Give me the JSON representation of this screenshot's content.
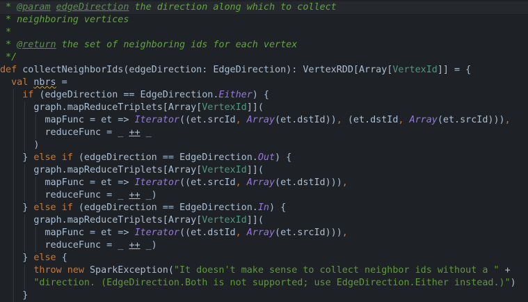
{
  "editor": {
    "highlighted_line": 0,
    "lines": [
      [
        [
          "c",
          " * "
        ],
        [
          "ct",
          "@param"
        ],
        [
          "c",
          " "
        ],
        [
          "ct",
          "edgeDirection"
        ],
        [
          "c",
          " the direction along which to collect"
        ]
      ],
      [
        [
          "c",
          " * neighboring vertices"
        ]
      ],
      [
        [
          "c",
          " *"
        ]
      ],
      [
        [
          "c",
          " * "
        ],
        [
          "ct",
          "@return"
        ],
        [
          "c",
          " the set of neighboring ids for each vertex"
        ]
      ],
      [
        [
          "c",
          " */"
        ]
      ],
      [
        [
          "k",
          "def "
        ],
        [
          "t",
          "collectNeighborIds(edgeDirection: EdgeDirection): VertexRDD[Array["
        ],
        [
          "ty",
          "VertexId"
        ],
        [
          "t",
          "]] = {"
        ]
      ],
      [
        [
          "t",
          "  "
        ],
        [
          "k",
          "val "
        ],
        [
          "w",
          "nbrs"
        ],
        [
          "t",
          " ="
        ]
      ],
      [
        [
          "t",
          "    "
        ],
        [
          "k",
          "if "
        ],
        [
          "t",
          "(edgeDirection == EdgeDirection."
        ],
        [
          "i",
          "Either"
        ],
        [
          "t",
          ") {"
        ]
      ],
      [
        [
          "t",
          "      graph.mapReduceTriplets[Array["
        ],
        [
          "ty",
          "VertexId"
        ],
        [
          "t",
          "]]("
        ]
      ],
      [
        [
          "t",
          "        mapFunc = et => "
        ],
        [
          "i",
          "Iterator"
        ],
        [
          "t",
          "((et.srcId"
        ],
        [
          "p",
          ", "
        ],
        [
          "i",
          "Array"
        ],
        [
          "t",
          "(et.dstId))"
        ],
        [
          "p",
          ", "
        ],
        [
          "t",
          "(et.dstId"
        ],
        [
          "p",
          ", "
        ],
        [
          "i",
          "Array"
        ],
        [
          "t",
          "(et.srcId)))"
        ],
        [
          "p",
          ","
        ]
      ],
      [
        [
          "t",
          "        reduceFunc = _ "
        ],
        [
          "u",
          "++"
        ],
        [
          "t",
          " _"
        ]
      ],
      [
        [
          "t",
          "      )"
        ]
      ],
      [
        [
          "t",
          "    } "
        ],
        [
          "k",
          "else if "
        ],
        [
          "t",
          "(edgeDirection == EdgeDirection."
        ],
        [
          "i",
          "Out"
        ],
        [
          "t",
          ") {"
        ]
      ],
      [
        [
          "t",
          "      graph.mapReduceTriplets[Array["
        ],
        [
          "ty",
          "VertexId"
        ],
        [
          "t",
          "]]("
        ]
      ],
      [
        [
          "t",
          "        mapFunc = et => "
        ],
        [
          "i",
          "Iterator"
        ],
        [
          "t",
          "((et.srcId"
        ],
        [
          "p",
          ", "
        ],
        [
          "i",
          "Array"
        ],
        [
          "t",
          "(et.dstId)))"
        ],
        [
          "p",
          ","
        ]
      ],
      [
        [
          "t",
          "        reduceFunc = _ "
        ],
        [
          "u",
          "++"
        ],
        [
          "t",
          " _)"
        ]
      ],
      [
        [
          "t",
          "    } "
        ],
        [
          "k",
          "else if "
        ],
        [
          "t",
          "(edgeDirection == EdgeDirection."
        ],
        [
          "i",
          "In"
        ],
        [
          "t",
          ") {"
        ]
      ],
      [
        [
          "t",
          "      graph.mapReduceTriplets[Array["
        ],
        [
          "ty",
          "VertexId"
        ],
        [
          "t",
          "]]("
        ]
      ],
      [
        [
          "t",
          "        mapFunc = et => "
        ],
        [
          "i",
          "Iterator"
        ],
        [
          "t",
          "((et.dstId"
        ],
        [
          "p",
          ", "
        ],
        [
          "i",
          "Array"
        ],
        [
          "t",
          "(et.srcId)))"
        ],
        [
          "p",
          ","
        ]
      ],
      [
        [
          "t",
          "        reduceFunc = _ "
        ],
        [
          "u",
          "++"
        ],
        [
          "t",
          " _)"
        ]
      ],
      [
        [
          "t",
          "    } "
        ],
        [
          "k",
          "else "
        ],
        [
          "t",
          "{"
        ]
      ],
      [
        [
          "t",
          "      "
        ],
        [
          "k",
          "throw new "
        ],
        [
          "t",
          "SparkException("
        ],
        [
          "s",
          "\"It doesn't make sense to collect neighbor ids without a \""
        ],
        [
          "t",
          " +"
        ]
      ],
      [
        [
          "s",
          "      \"direction. (EdgeDirection.Both is not supported; use EdgeDirection.Either instead.)\""
        ],
        [
          "t",
          ")"
        ]
      ],
      [
        [
          "t",
          "    }"
        ]
      ]
    ]
  }
}
